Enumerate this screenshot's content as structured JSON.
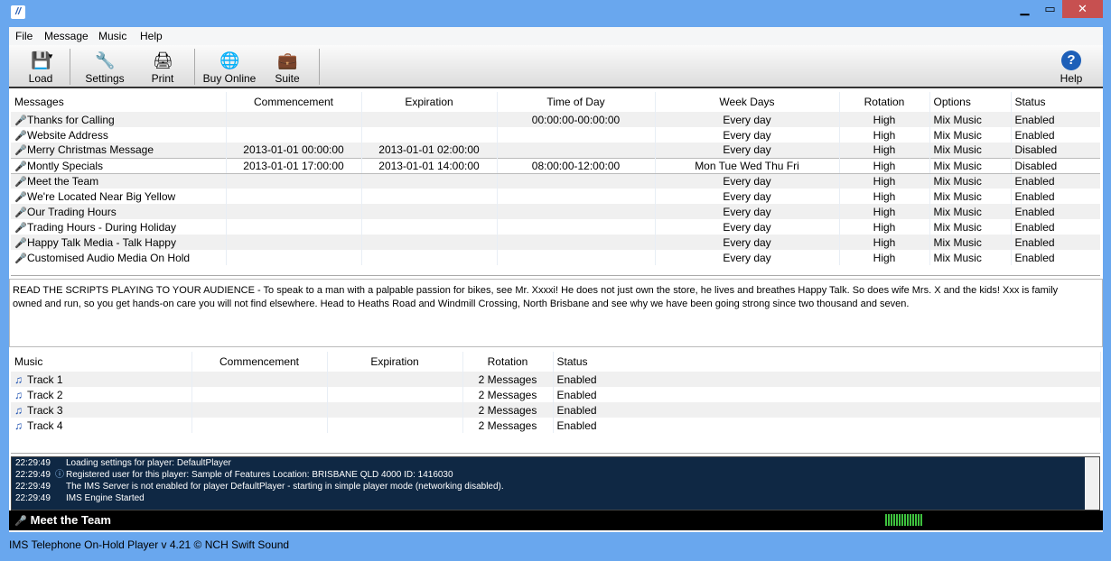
{
  "window": {
    "icon": "nch-app-icon",
    "controls": [
      "minimize",
      "maximize",
      "close"
    ]
  },
  "menu": [
    "File",
    "Message",
    "Music",
    "Help"
  ],
  "toolbar": {
    "load": "Load",
    "settings": "Settings",
    "print": "Print",
    "buy_online": "Buy Online",
    "suite": "Suite",
    "help": "Help"
  },
  "messages": {
    "columns": [
      "Messages",
      "Commencement",
      "Expiration",
      "Time of Day",
      "Week Days",
      "Rotation",
      "Options",
      "Status"
    ],
    "rows": [
      [
        "Thanks for Calling",
        "",
        "",
        "00:00:00-00:00:00",
        "Every day",
        "High",
        "Mix Music",
        "Enabled"
      ],
      [
        "Website Address",
        "",
        "",
        "",
        "Every day",
        "High",
        "Mix Music",
        "Enabled"
      ],
      [
        "Merry Christmas Message",
        "2013-01-01 00:00:00",
        "2013-01-01 02:00:00",
        "",
        "Every day",
        "High",
        "Mix Music",
        "Disabled"
      ],
      [
        "Montly Specials",
        "2013-01-01 17:00:00",
        "2013-01-01 14:00:00",
        "08:00:00-12:00:00",
        "Mon Tue Wed Thu Fri",
        "High",
        "Mix Music",
        "Disabled"
      ],
      [
        "Meet the Team",
        "",
        "",
        "",
        "Every day",
        "High",
        "Mix Music",
        "Enabled"
      ],
      [
        "We're Located Near Big Yellow",
        "",
        "",
        "",
        "Every day",
        "High",
        "Mix Music",
        "Enabled"
      ],
      [
        "Our Trading Hours",
        "",
        "",
        "",
        "Every day",
        "High",
        "Mix Music",
        "Enabled"
      ],
      [
        "Trading Hours - During Holiday",
        "",
        "",
        "",
        "Every day",
        "High",
        "Mix Music",
        "Enabled"
      ],
      [
        "Happy Talk Media - Talk Happy",
        "",
        "",
        "",
        "Every day",
        "High",
        "Mix Music",
        "Enabled"
      ],
      [
        "Customised Audio Media On Hold",
        "",
        "",
        "",
        "Every day",
        "High",
        "Mix Music",
        "Enabled"
      ]
    ]
  },
  "script_text": "READ THE SCRIPTS PLAYING TO YOUR AUDIENCE - To speak to a man with a palpable passion for bikes, see Mr. Xxxxi! He does not just own the store, he lives and breathes Happy Talk. So does wife Mrs. X and the kids! Xxx is family owned and run, so you get hands-on  care you will not find elsewhere. Head to Heaths Road and Windmill Crossing, North Brisbane  and see why we have been going strong since two thousand and seven.",
  "music": {
    "columns": [
      "Music",
      "Commencement",
      "Expiration",
      "Rotation",
      "Status"
    ],
    "rows": [
      [
        "Track 1",
        "",
        "",
        "2 Messages",
        "Enabled"
      ],
      [
        "Track 2",
        "",
        "",
        "2 Messages",
        "Enabled"
      ],
      [
        "Track 3",
        "",
        "",
        "2 Messages",
        "Enabled"
      ],
      [
        "Track 4",
        "",
        "",
        "2 Messages",
        "Enabled"
      ]
    ]
  },
  "log": [
    {
      "time": "22:29:49",
      "text": "Loading settings for player: DefaultPlayer"
    },
    {
      "time": "22:29:49",
      "text": "Registered user for this player: Sample of Features Location: BRISBANE QLD  4000 ID: 1416030",
      "icon": "info"
    },
    {
      "time": "22:29:49",
      "text": "The IMS Server is not enabled for player DefaultPlayer - starting in simple player mode (networking disabled)."
    },
    {
      "time": "22:29:49",
      "text": "IMS Engine Started"
    }
  ],
  "now_playing": "Meet the Team",
  "footer": "IMS Telephone On-Hold Player v 4.21 © NCH Swift Sound",
  "colors": {
    "frame": "#69a7ee",
    "log_bg": "#0f2844",
    "meter": "#3ec13e",
    "close": "#c75050"
  }
}
